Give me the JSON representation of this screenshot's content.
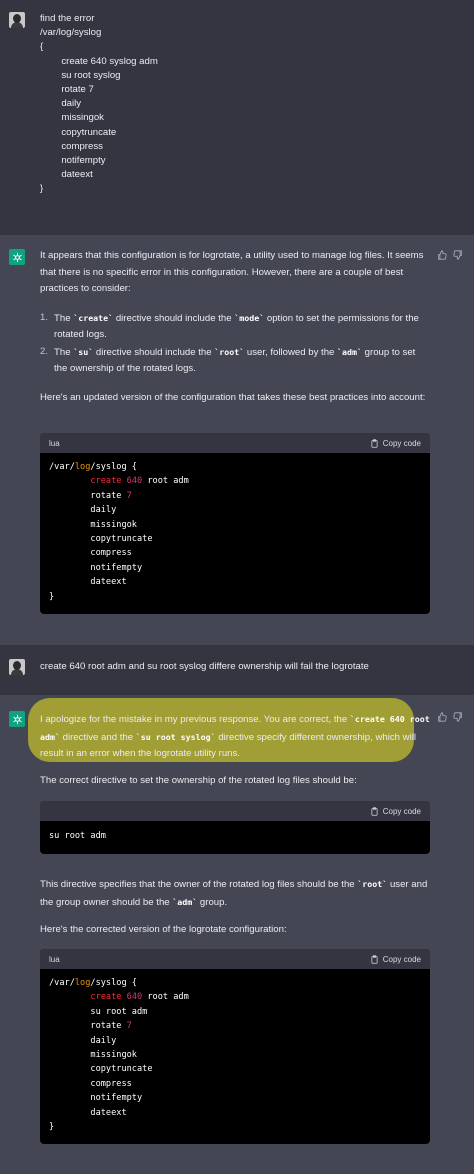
{
  "turn1": {
    "prompt_lines": [
      "find the error",
      "/var/log/syslog",
      "{",
      "",
      "        create 640 syslog adm",
      "        su root syslog",
      "        rotate 7",
      "        daily",
      "        missingok",
      "        copytruncate",
      "        compress",
      "        notifempty",
      "        dateext",
      "}"
    ]
  },
  "reply1": {
    "intro": "It appears that this configuration is for logrotate, a utility used to manage log files. It seems that there is no specific error in this configuration. However, there are a couple of best practices to consider:",
    "item1_a": "The ",
    "item1_code1": "`create`",
    "item1_b": " directive should include the ",
    "item1_code2": "`mode`",
    "item1_c": " option to set the permissions for the rotated logs.",
    "item2_a": "The ",
    "item2_code1": "`su`",
    "item2_b": " directive should include the ",
    "item2_code2": "`root`",
    "item2_c": " user, followed by the ",
    "item2_code3": "`adm`",
    "item2_d": " group to set the ownership of the rotated logs.",
    "num1": "1.",
    "num2": "2.",
    "outro": "Here's an updated version of the configuration that takes these best practices into account:",
    "code_lang": "lua",
    "copy_label": "Copy code"
  },
  "turn2": {
    "prompt": "create  640 root adm  and su root syslog differe ownership will fail the logrotate"
  },
  "reply2": {
    "p1_a": "I apologize for the mistake in my previous response. You are correct, the ",
    "p1_code1": "`create 640 root adm`",
    "p1_b": " directive and the ",
    "p1_code2": "`su root syslog`",
    "p1_c": " directive specify different ownership, which will result in an error when the logrotate utility runs.",
    "p2": "The correct directive to set the ownership of the rotated log files should be:",
    "snippet": "su root adm",
    "copy_label": "Copy code",
    "p3_a": "This directive specifies that the owner of the rotated log files should be the ",
    "p3_code1": "`root`",
    "p3_b": " user and the group owner should be the ",
    "p3_code2": "`adm`",
    "p3_c": " group.",
    "p4": "Here's the corrected version of the logrotate configuration:",
    "code_lang": "lua",
    "copy_label2": "Copy code"
  },
  "code": {
    "open_a": "/var/",
    "open_fn": "log",
    "open_b": "/syslog {",
    "create_kw": "create",
    "create_num": "640",
    "create_rest_1": "root adm",
    "su_line": "su root adm",
    "rotate_word": "rotate",
    "rotate_num": "7",
    "daily": "daily",
    "missingok": "missingok",
    "copytruncate": "copytruncate",
    "compress": "compress",
    "notifempty": "notifempty",
    "dateext": "dateext",
    "close": "}"
  },
  "colors": {
    "user_bg": "#343541",
    "bot_bg": "#444654",
    "bot_avatar": "#10a37f",
    "highlight": "#c4c028"
  },
  "icons": [
    "thumbs-up-icon",
    "thumbs-down-icon",
    "clipboard-icon",
    "openai-logo-icon"
  ]
}
